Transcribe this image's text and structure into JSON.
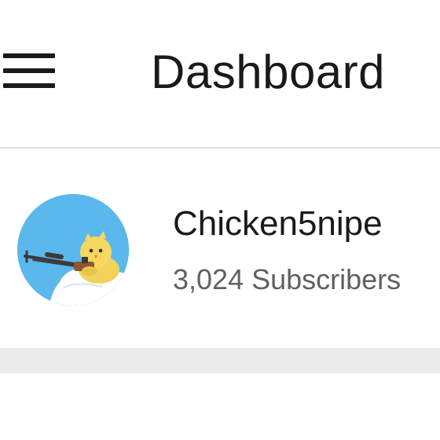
{
  "header": {
    "title": "Dashboard",
    "menu_icon": "hamburger-menu-icon"
  },
  "channel": {
    "name": "Chicken5nipe",
    "subscribers": "3,024 Subscribers",
    "avatar": "chick-with-sniper-rifle-avatar"
  },
  "colors": {
    "text_primary": "#1a1a1a",
    "text_secondary": "#606060",
    "avatar_background": "#5bb8ec",
    "divider": "#e3e3e3",
    "section_separator": "#ebebeb"
  }
}
